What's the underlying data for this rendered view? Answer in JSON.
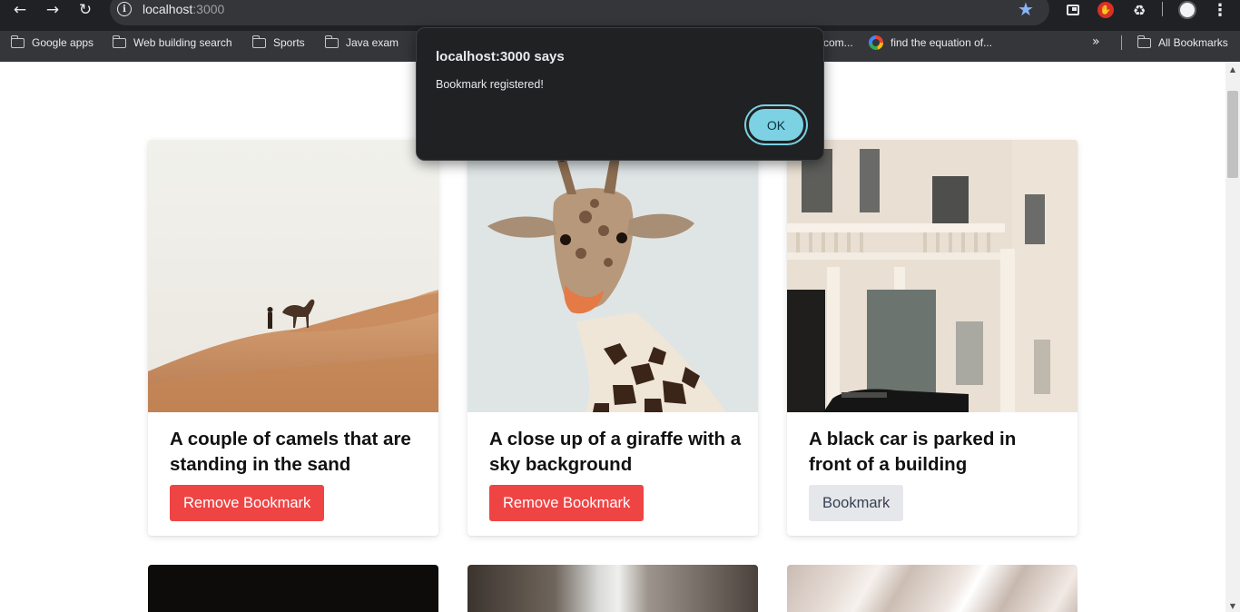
{
  "browser": {
    "url_host": "localhost",
    "url_port": ":3000",
    "icons": {
      "back": "back-arrow-icon",
      "forward": "forward-arrow-icon",
      "reload": "reload-icon",
      "site_info": "info-icon",
      "bookmark_star": "star-icon",
      "tab_search": "tab-search-icon",
      "extension_stop": "stop-extension-icon",
      "extensions": "puzzle-icon",
      "profile": "avatar-icon",
      "menu": "kebab-menu-icon"
    },
    "accent_color": "#8ab4f8"
  },
  "bookmarks_bar": {
    "items": [
      {
        "label": "Google apps",
        "icon": "folder-icon"
      },
      {
        "label": "Web building search",
        "icon": "folder-icon"
      },
      {
        "label": "Sports",
        "icon": "folder-icon"
      },
      {
        "label": "Java exam",
        "icon": "folder-icon"
      },
      {
        "label": "com...",
        "icon": "none"
      },
      {
        "label": "find the equation of...",
        "icon": "google-icon"
      }
    ],
    "overflow_icon": "chevron-double-right-icon",
    "all_bookmarks": "All Bookmarks"
  },
  "dialog": {
    "title": "localhost:3000 says",
    "message": "Bookmark registered!",
    "ok_label": "OK",
    "ok_color": "#7cd1e3"
  },
  "cards": [
    {
      "title": "A couple of camels that are standing in the sand",
      "button": "Remove Bookmark",
      "bookmarked": true,
      "image": "desert-camels-photo"
    },
    {
      "title": "A close up of a giraffe with a sky background",
      "button": "Remove Bookmark",
      "bookmarked": true,
      "image": "giraffe-photo"
    },
    {
      "title": "A black car is parked in front of a building",
      "button": "Bookmark",
      "bookmarked": false,
      "image": "building-car-photo"
    }
  ],
  "next_row_images": [
    "dark-photo",
    "waterfall-photo",
    "light-beams-photo"
  ],
  "colors": {
    "remove_button": "#ef4444",
    "bookmark_button": "#e5e7eb"
  }
}
